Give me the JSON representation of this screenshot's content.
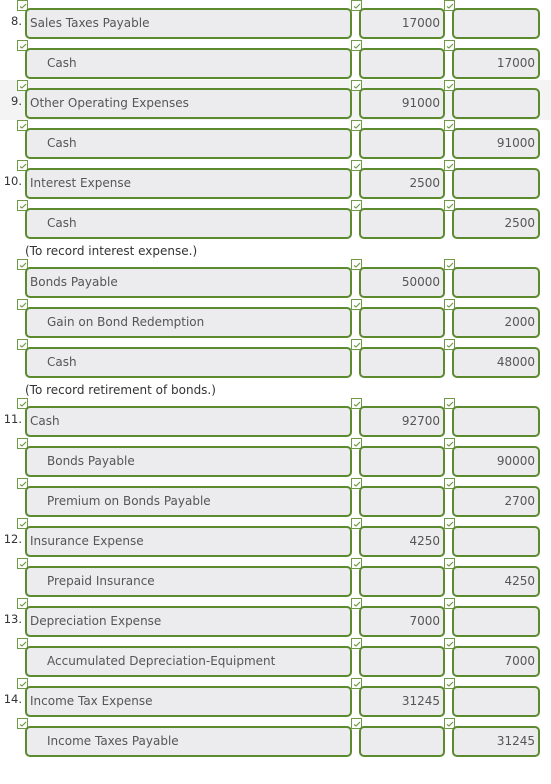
{
  "rows": [
    {
      "num": "8.",
      "account": "Sales Taxes Payable",
      "indent": false,
      "debit": "17000",
      "credit": ""
    },
    {
      "num": "",
      "account": "Cash",
      "indent": true,
      "debit": "",
      "credit": "17000"
    },
    {
      "num": "9.",
      "account": "Other Operating Expenses",
      "indent": false,
      "debit": "91000",
      "credit": "",
      "highlight": true
    },
    {
      "num": "",
      "account": "Cash",
      "indent": true,
      "debit": "",
      "credit": "91000"
    },
    {
      "num": "10.",
      "account": "Interest Expense",
      "indent": false,
      "debit": "2500",
      "credit": ""
    },
    {
      "num": "",
      "account": "Cash",
      "indent": true,
      "debit": "",
      "credit": "2500"
    },
    {
      "note": "(To record interest expense.)"
    },
    {
      "num": "",
      "account": "Bonds Payable",
      "indent": false,
      "debit": "50000",
      "credit": ""
    },
    {
      "num": "",
      "account": "Gain on Bond Redemption",
      "indent": true,
      "debit": "",
      "credit": "2000"
    },
    {
      "num": "",
      "account": "Cash",
      "indent": true,
      "debit": "",
      "credit": "48000"
    },
    {
      "note": "(To record retirement of bonds.)"
    },
    {
      "num": "11.",
      "account": "Cash",
      "indent": false,
      "debit": "92700",
      "credit": ""
    },
    {
      "num": "",
      "account": "Bonds Payable",
      "indent": true,
      "debit": "",
      "credit": "90000"
    },
    {
      "num": "",
      "account": "Premium on Bonds Payable",
      "indent": true,
      "debit": "",
      "credit": "2700"
    },
    {
      "num": "12.",
      "account": "Insurance Expense",
      "indent": false,
      "debit": "4250",
      "credit": ""
    },
    {
      "num": "",
      "account": "Prepaid Insurance",
      "indent": true,
      "debit": "",
      "credit": "4250"
    },
    {
      "num": "13.",
      "account": "Depreciation Expense",
      "indent": false,
      "debit": "7000",
      "credit": ""
    },
    {
      "num": "",
      "account": "Accumulated Depreciation-Equipment",
      "indent": true,
      "debit": "",
      "credit": "7000"
    },
    {
      "num": "14.",
      "account": "Income Tax Expense",
      "indent": false,
      "debit": "31245",
      "credit": ""
    },
    {
      "num": "",
      "account": "Income Taxes Payable",
      "indent": true,
      "debit": "",
      "credit": "31245"
    }
  ],
  "colors": {
    "border": "#5b8a2f",
    "field": "#ececee"
  },
  "icons": {
    "check": "checkmark-icon"
  }
}
